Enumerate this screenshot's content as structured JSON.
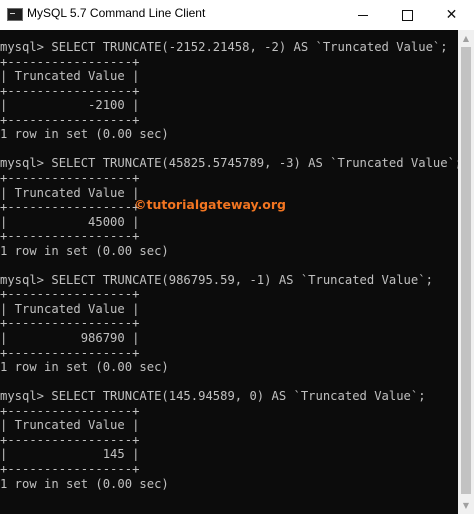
{
  "window": {
    "title": "MySQL 5.7 Command Line Client",
    "buttons": {
      "minimize": "—",
      "maximize": "☐",
      "close": "✕"
    },
    "colors": {
      "background": "#0c0c0c",
      "text": "#c0c0c0",
      "watermark": "#f27521"
    }
  },
  "console_lines": [
    "mysql> SELECT TRUNCATE(-2152.21458, -2) AS `Truncated Value`;",
    "+-----------------+",
    "| Truncated Value |",
    "+-----------------+",
    "|           -2100 |",
    "+-----------------+",
    "1 row in set (0.00 sec)",
    "",
    "mysql> SELECT TRUNCATE(45825.5745789, -3) AS `Truncated Value`;",
    "+-----------------+",
    "| Truncated Value |",
    "+-----------------+",
    "|           45000 |",
    "+-----------------+",
    "1 row in set (0.00 sec)",
    "",
    "mysql> SELECT TRUNCATE(986795.59, -1) AS `Truncated Value`;",
    "+-----------------+",
    "| Truncated Value |",
    "+-----------------+",
    "|          986790 |",
    "+-----------------+",
    "1 row in set (0.00 sec)",
    "",
    "mysql> SELECT TRUNCATE(145.94589, 0) AS `Truncated Value`;",
    "+-----------------+",
    "| Truncated Value |",
    "+-----------------+",
    "|             145 |",
    "+-----------------+",
    "1 row in set (0.00 sec)"
  ],
  "watermark": "©tutorialgateway.org",
  "scrollbar": {
    "up_arrow": "▲",
    "down_arrow": "▼"
  }
}
